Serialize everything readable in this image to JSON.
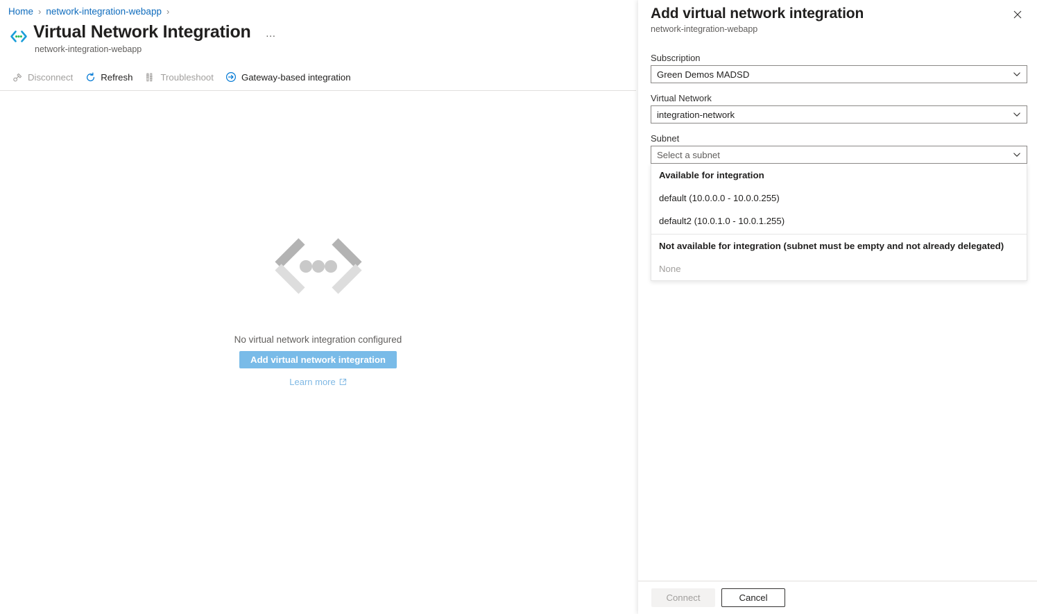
{
  "breadcrumb": {
    "items": [
      {
        "label": "Home"
      },
      {
        "label": "network-integration-webapp"
      }
    ],
    "separator": "›"
  },
  "page": {
    "title": "Virtual Network Integration",
    "subtitle": "network-integration-webapp",
    "more_label": "…",
    "icon": "vnet-integration-icon"
  },
  "command_bar": {
    "items": [
      {
        "label": "Disconnect",
        "icon": "disconnect-icon",
        "disabled": true
      },
      {
        "label": "Refresh",
        "icon": "refresh-icon",
        "disabled": false
      },
      {
        "label": "Troubleshoot",
        "icon": "troubleshoot-icon",
        "disabled": true
      },
      {
        "label": "Gateway-based integration",
        "icon": "arrow-right-circle-icon",
        "disabled": false
      }
    ]
  },
  "empty_state": {
    "icon": "vnet-chevron-dots-icon",
    "message": "No virtual network integration configured",
    "primary_button": "Add virtual network integration",
    "learn_more": "Learn more",
    "learn_more_icon": "external-link-icon"
  },
  "panel": {
    "title": "Add virtual network integration",
    "subtitle": "network-integration-webapp",
    "close_icon": "close-icon",
    "fields": {
      "subscription": {
        "label": "Subscription",
        "value": "Green Demos MADSD",
        "chevron_icon": "chevron-down-icon"
      },
      "virtual_network": {
        "label": "Virtual Network",
        "value": "integration-network",
        "chevron_icon": "chevron-down-icon"
      },
      "subnet": {
        "label": "Subnet",
        "placeholder": "Select a subnet",
        "value": "",
        "chevron_icon": "chevron-down-icon"
      }
    },
    "subnet_dropdown": {
      "groups": [
        {
          "header": "Available for integration",
          "items": [
            {
              "label": "default (10.0.0.0 - 10.0.0.255)",
              "disabled": false
            },
            {
              "label": "default2 (10.0.1.0 - 10.0.1.255)",
              "disabled": false
            }
          ]
        },
        {
          "header": "Not available for integration (subnet must be empty and not already delegated)",
          "items": [
            {
              "label": "None",
              "disabled": true
            }
          ]
        }
      ]
    },
    "footer": {
      "connect_label": "Connect",
      "cancel_label": "Cancel"
    }
  },
  "colors": {
    "link": "#0f6cbd",
    "accent_button": "#79bbe8",
    "muted_text": "#605e5c",
    "disabled_text": "#a19f9d",
    "border": "#e1dfdd",
    "icon_blue": "#0078d4",
    "icon_green": "#2fbd5a"
  }
}
